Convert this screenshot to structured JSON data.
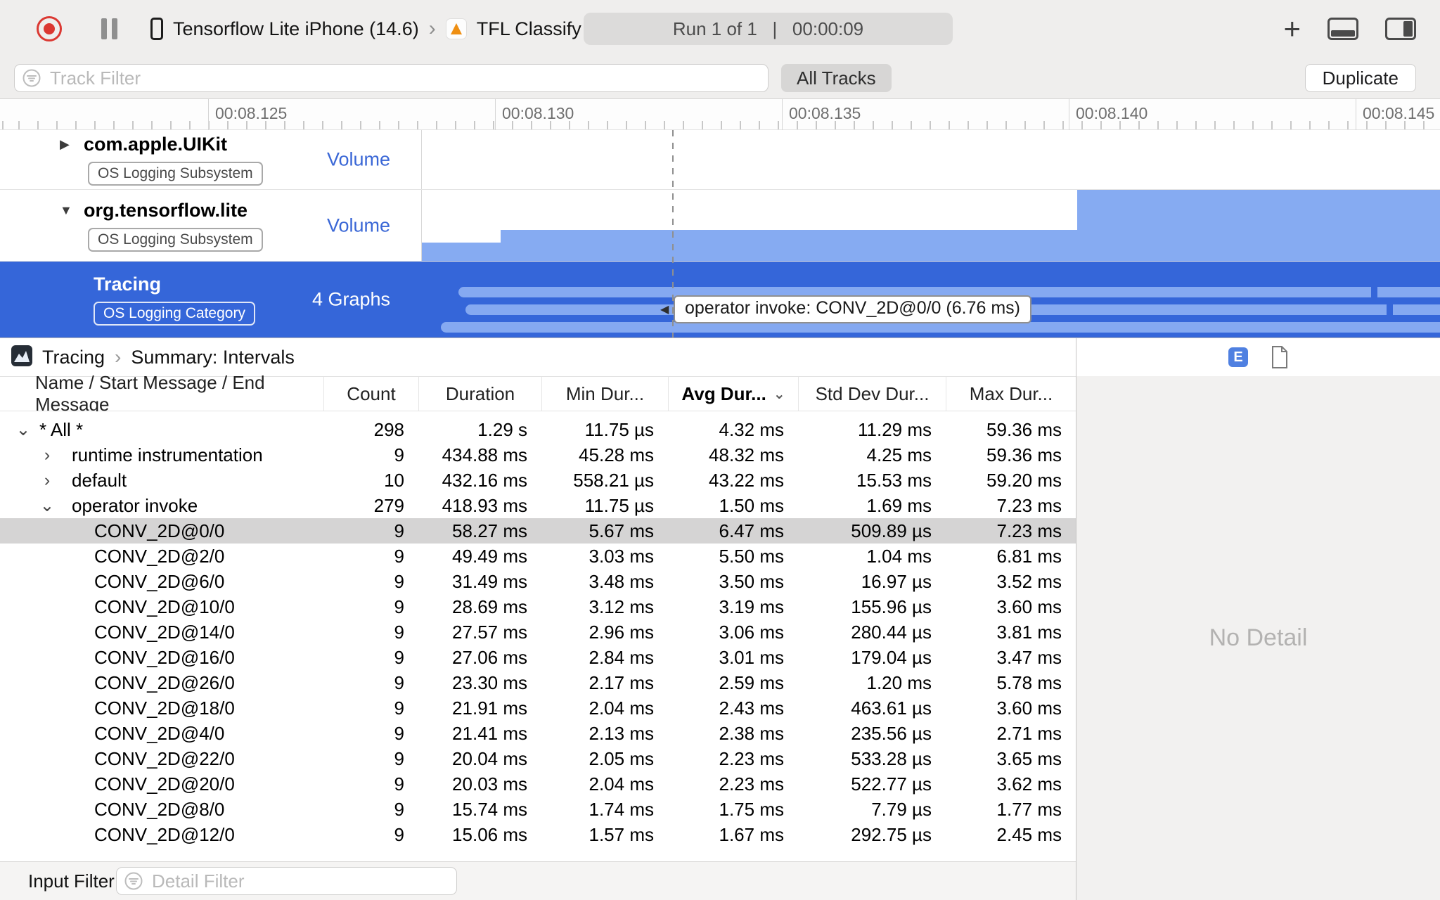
{
  "colors": {
    "selection_blue": "#3566d9",
    "chart_blue": "#86abf2",
    "pill_blue": "#85a9f1",
    "accent_blue": "#3a67d6",
    "record_red": "#db3832",
    "e_badge_blue": "#4f80e1",
    "selected_row_gray": "#d5d4d4"
  },
  "icons": {
    "disclosure_collapsed": "▶",
    "disclosure_expanded": "▼",
    "row_expanded": "⌄",
    "row_collapsed": "›",
    "sort_chevron": "⌄",
    "breadcrumb_chevron": "›",
    "device_chevron": "›",
    "tooltip_arrow": "◀",
    "plus": "+"
  },
  "toolbar": {
    "device_name": "Tensorflow Lite iPhone (14.6)",
    "target_name": "TFL Classify",
    "run_status": "Run 1 of 1   |   00:00:09"
  },
  "filter_bar": {
    "track_filter_placeholder": "Track Filter",
    "all_tracks_label": "All Tracks",
    "duplicate_label": "Duplicate"
  },
  "ruler": {
    "labels": [
      "00:08.125",
      "00:08.130",
      "00:08.135",
      "00:08.140",
      "00:08.145"
    ]
  },
  "tracks": [
    {
      "name": "com.apple.UIKit",
      "badge": "OS Logging Subsystem",
      "meta": "Volume",
      "disclosure": "collapsed"
    },
    {
      "name": "org.tensorflow.lite",
      "badge": "OS Logging Subsystem",
      "meta": "Volume",
      "disclosure": "expanded"
    },
    {
      "name": "Tracing",
      "badge": "OS Logging Category",
      "meta": "4 Graphs",
      "selected": true
    }
  ],
  "track_tooltip": "operator invoke: CONV_2D@0/0 (6.76 ms)",
  "detail_header": {
    "breadcrumb_root": "Tracing",
    "breadcrumb_leaf": "Summary: Intervals",
    "e_badge_label": "E"
  },
  "table": {
    "columns": [
      "Name / Start Message / End Message",
      "Count",
      "Duration",
      "Min Dur...",
      "Avg Dur...",
      "Std Dev Dur...",
      "Max Dur..."
    ],
    "sorted_column": "Avg Dur...",
    "rows": [
      {
        "level": 0,
        "expander": "down",
        "name": "* All *",
        "values": [
          "298",
          "1.29 s",
          "11.75 µs",
          "4.32 ms",
          "11.29 ms",
          "59.36 ms"
        ]
      },
      {
        "level": 1,
        "expander": "right",
        "name": "runtime instrumentation",
        "values": [
          "9",
          "434.88 ms",
          "45.28 ms",
          "48.32 ms",
          "4.25 ms",
          "59.36 ms"
        ]
      },
      {
        "level": 1,
        "expander": "right",
        "name": "default",
        "values": [
          "10",
          "432.16 ms",
          "558.21 µs",
          "43.22 ms",
          "15.53 ms",
          "59.20 ms"
        ]
      },
      {
        "level": 1,
        "expander": "down",
        "name": "operator invoke",
        "values": [
          "279",
          "418.93 ms",
          "11.75 µs",
          "1.50 ms",
          "1.69 ms",
          "7.23 ms"
        ]
      },
      {
        "level": 2,
        "name": "CONV_2D@0/0",
        "selected": true,
        "values": [
          "9",
          "58.27 ms",
          "5.67 ms",
          "6.47 ms",
          "509.89 µs",
          "7.23 ms"
        ]
      },
      {
        "level": 2,
        "name": "CONV_2D@2/0",
        "values": [
          "9",
          "49.49 ms",
          "3.03 ms",
          "5.50 ms",
          "1.04 ms",
          "6.81 ms"
        ]
      },
      {
        "level": 2,
        "name": "CONV_2D@6/0",
        "values": [
          "9",
          "31.49 ms",
          "3.48 ms",
          "3.50 ms",
          "16.97 µs",
          "3.52 ms"
        ]
      },
      {
        "level": 2,
        "name": "CONV_2D@10/0",
        "values": [
          "9",
          "28.69 ms",
          "3.12 ms",
          "3.19 ms",
          "155.96 µs",
          "3.60 ms"
        ]
      },
      {
        "level": 2,
        "name": "CONV_2D@14/0",
        "values": [
          "9",
          "27.57 ms",
          "2.96 ms",
          "3.06 ms",
          "280.44 µs",
          "3.81 ms"
        ]
      },
      {
        "level": 2,
        "name": "CONV_2D@16/0",
        "values": [
          "9",
          "27.06 ms",
          "2.84 ms",
          "3.01 ms",
          "179.04 µs",
          "3.47 ms"
        ]
      },
      {
        "level": 2,
        "name": "CONV_2D@26/0",
        "values": [
          "9",
          "23.30 ms",
          "2.17 ms",
          "2.59 ms",
          "1.20 ms",
          "5.78 ms"
        ]
      },
      {
        "level": 2,
        "name": "CONV_2D@18/0",
        "values": [
          "9",
          "21.91 ms",
          "2.04 ms",
          "2.43 ms",
          "463.61 µs",
          "3.60 ms"
        ]
      },
      {
        "level": 2,
        "name": "CONV_2D@4/0",
        "values": [
          "9",
          "21.41 ms",
          "2.13 ms",
          "2.38 ms",
          "235.56 µs",
          "2.71 ms"
        ]
      },
      {
        "level": 2,
        "name": "CONV_2D@22/0",
        "values": [
          "9",
          "20.04 ms",
          "2.05 ms",
          "2.23 ms",
          "533.28 µs",
          "3.65 ms"
        ]
      },
      {
        "level": 2,
        "name": "CONV_2D@20/0",
        "values": [
          "9",
          "20.03 ms",
          "2.04 ms",
          "2.23 ms",
          "522.77 µs",
          "3.62 ms"
        ]
      },
      {
        "level": 2,
        "name": "CONV_2D@8/0",
        "values": [
          "9",
          "15.74 ms",
          "1.74 ms",
          "1.75 ms",
          "7.79 µs",
          "1.77 ms"
        ]
      },
      {
        "level": 2,
        "name": "CONV_2D@12/0",
        "values": [
          "9",
          "15.06 ms",
          "1.57 ms",
          "1.67 ms",
          "292.75 µs",
          "2.45 ms"
        ]
      }
    ]
  },
  "detail_panel": {
    "empty_text": "No Detail"
  },
  "bottom_bar": {
    "input_filter_label": "Input Filter",
    "detail_filter_placeholder": "Detail Filter"
  }
}
